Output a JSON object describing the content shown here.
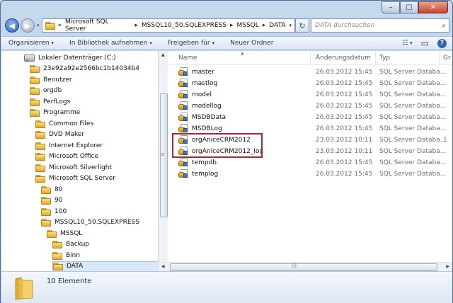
{
  "window": {
    "controls": {
      "minimize": "–",
      "maximize": "□",
      "close": "✕"
    }
  },
  "address": {
    "back_icon": "◀",
    "forward_icon": "▶",
    "prefix": "«",
    "crumbs": [
      "Microsoft SQL Server",
      "MSSQL10_50.SQLEXPRESS",
      "MSSQL",
      "DATA"
    ],
    "separator": "▸",
    "dropdown": "▾",
    "refresh_icon": "↻"
  },
  "search": {
    "placeholder": "DATA durchsuchen",
    "icon": "⌕"
  },
  "toolbar": {
    "organize": "Organisieren",
    "library": "In Bibliothek aufnehmen",
    "share": "Freigeben für",
    "new_folder": "Neuer Ordner",
    "arrow": "▾",
    "view_icon": "☷",
    "view_arrow": "▾",
    "pane_icon": "▭",
    "help": "?"
  },
  "nav": {
    "items": [
      {
        "label": "Lokaler Datenträger (C:)",
        "icon": "drive",
        "indent": 0
      },
      {
        "label": "23e92a92e2566bc1b14034b4",
        "icon": "folder",
        "indent": 1
      },
      {
        "label": "Benutzer",
        "icon": "folder",
        "indent": 1
      },
      {
        "label": "orgdb",
        "icon": "folder",
        "indent": 1
      },
      {
        "label": "PerfLogs",
        "icon": "folder",
        "indent": 1
      },
      {
        "label": "Programme",
        "icon": "folder",
        "indent": 1
      },
      {
        "label": "Common Files",
        "icon": "folder",
        "indent": 2
      },
      {
        "label": "DVD Maker",
        "icon": "folder",
        "indent": 2
      },
      {
        "label": "Internet Explorer",
        "icon": "folder",
        "indent": 2
      },
      {
        "label": "Microsoft Office",
        "icon": "folder",
        "indent": 2
      },
      {
        "label": "Microsoft Silverlight",
        "icon": "folder",
        "indent": 2
      },
      {
        "label": "Microsoft SQL Server",
        "icon": "folder",
        "indent": 2
      },
      {
        "label": "80",
        "icon": "folder",
        "indent": 3
      },
      {
        "label": "90",
        "icon": "folder",
        "indent": 3
      },
      {
        "label": "100",
        "icon": "folder",
        "indent": 3
      },
      {
        "label": "MSSQL10_50.SQLEXPRESS",
        "icon": "folder",
        "indent": 3
      },
      {
        "label": "MSSQL",
        "icon": "folder",
        "indent": 4
      },
      {
        "label": "Backup",
        "icon": "folder",
        "indent": 5
      },
      {
        "label": "Binn",
        "icon": "folder",
        "indent": 5
      },
      {
        "label": "DATA",
        "icon": "folder",
        "indent": 5,
        "selected": true
      }
    ]
  },
  "columns": {
    "name": "Name",
    "date": "Änderungsdatum",
    "type": "Typ",
    "size": "Gr"
  },
  "files": [
    {
      "name": "master",
      "date": "26.03.2012 15:45",
      "type": "SQL Server Databa...",
      "size": ""
    },
    {
      "name": "mastlog",
      "date": "26.03.2012 15:45",
      "type": "SQL Server Databa...",
      "size": ""
    },
    {
      "name": "model",
      "date": "26.03.2012 15:45",
      "type": "SQL Server Databa...",
      "size": ""
    },
    {
      "name": "modellog",
      "date": "26.03.2012 15:45",
      "type": "SQL Server Databa...",
      "size": ""
    },
    {
      "name": "MSDBData",
      "date": "26.03.2012 15:45",
      "type": "SQL Server Databa...",
      "size": ""
    },
    {
      "name": "MSDBLog",
      "date": "26.03.2012 15:45",
      "type": "SQL Server Databa...",
      "size": ""
    },
    {
      "name": "orgAniceCRM2012",
      "date": "23.03.2012 10:11",
      "type": "SQL Server Databa...",
      "size": "1"
    },
    {
      "name": "orgAniceCRM2012_log",
      "date": "23.03.2012 10:11",
      "type": "SQL Server Databa...",
      "size": ""
    },
    {
      "name": "tempdb",
      "date": "26.03.2012 15:45",
      "type": "SQL Server Databa...",
      "size": ""
    },
    {
      "name": "templog",
      "date": "26.03.2012 15:45",
      "type": "SQL Server Databa...",
      "size": ""
    }
  ],
  "details": {
    "count": "10 Elemente"
  },
  "scroll": {
    "up": "▲",
    "left": "◀",
    "right": "▶",
    "grip_v": "≡",
    "grip_h": "|||"
  },
  "colors": {
    "highlight": "#b3232a",
    "selection": "#d9e8f8"
  }
}
